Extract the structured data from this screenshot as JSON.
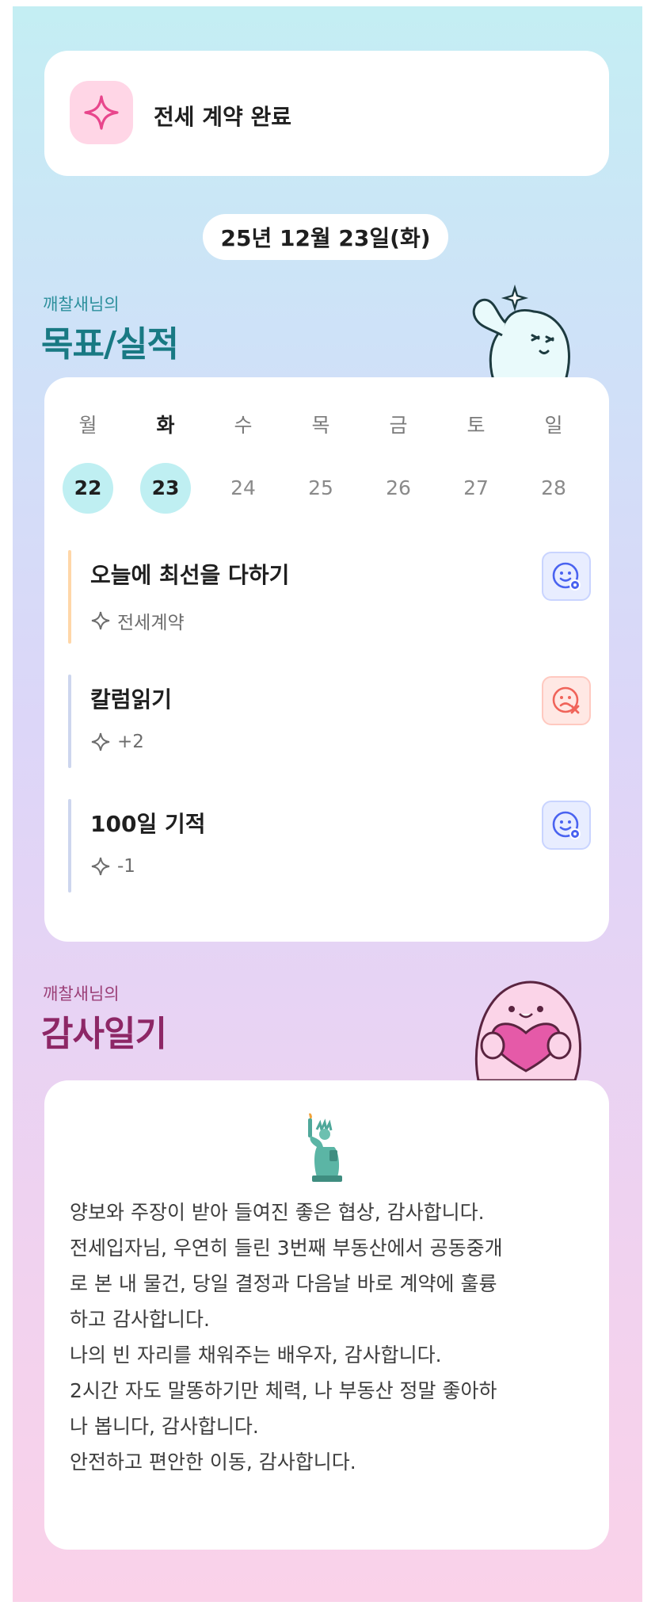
{
  "achievement": {
    "icon": "sparkle-icon",
    "label": "전세 계약 완료"
  },
  "date": "25년 12월 23일(화)",
  "goals_section": {
    "owner": "깨찰새님의",
    "title": "목표/실적"
  },
  "week": {
    "days": [
      {
        "name": "월",
        "date": "22",
        "highlighted": true,
        "current": false
      },
      {
        "name": "화",
        "date": "23",
        "highlighted": true,
        "current": true
      },
      {
        "name": "수",
        "date": "24",
        "highlighted": false,
        "current": false
      },
      {
        "name": "목",
        "date": "25",
        "highlighted": false,
        "current": false
      },
      {
        "name": "금",
        "date": "26",
        "highlighted": false,
        "current": false
      },
      {
        "name": "토",
        "date": "27",
        "highlighted": false,
        "current": false
      },
      {
        "name": "일",
        "date": "28",
        "highlighted": false,
        "current": false
      }
    ]
  },
  "goals": [
    {
      "title": "오늘에 최선을 다하기",
      "detail": "전세계약",
      "bar_color": "#ffd7a8",
      "status": "smile-face-icon"
    },
    {
      "title": "칼럼읽기",
      "detail": "+2",
      "bar_color": "#cdd6ee",
      "status": "sad-face-x-icon"
    },
    {
      "title": "100일 기적",
      "detail": "-1",
      "bar_color": "#cdd6ee",
      "status": "smile-face-icon"
    }
  ],
  "gratitude_section": {
    "owner": "깨찰새님의",
    "title": "감사일기",
    "icon": "statue-of-liberty-icon"
  },
  "gratitude_lines": [
    "양보와 주장이 받아 들여진 좋은 협상, 감사합니다.",
    "전세입자님, 우연히 들린 3번째 부동산에서 공동중개",
    "로 본 내 물건, 당일 결정과 다음날 바로 계약에 훌륭",
    "하고 감사합니다.",
    "나의 빈 자리를 채워주는 배우자, 감사합니다.",
    "2시간 자도 말똥하기만 체력, 나 부동산 정말 좋아하",
    "나 봅니다, 감사합니다.",
    "안전하고 편안한 이동, 감사합니다."
  ],
  "colors": {
    "goals_title": "#187983",
    "gratitude_title": "#8d2766",
    "day_highlight": "#bfeff2",
    "good_face": "#4a63f0",
    "bad_face": "#f0645a"
  }
}
